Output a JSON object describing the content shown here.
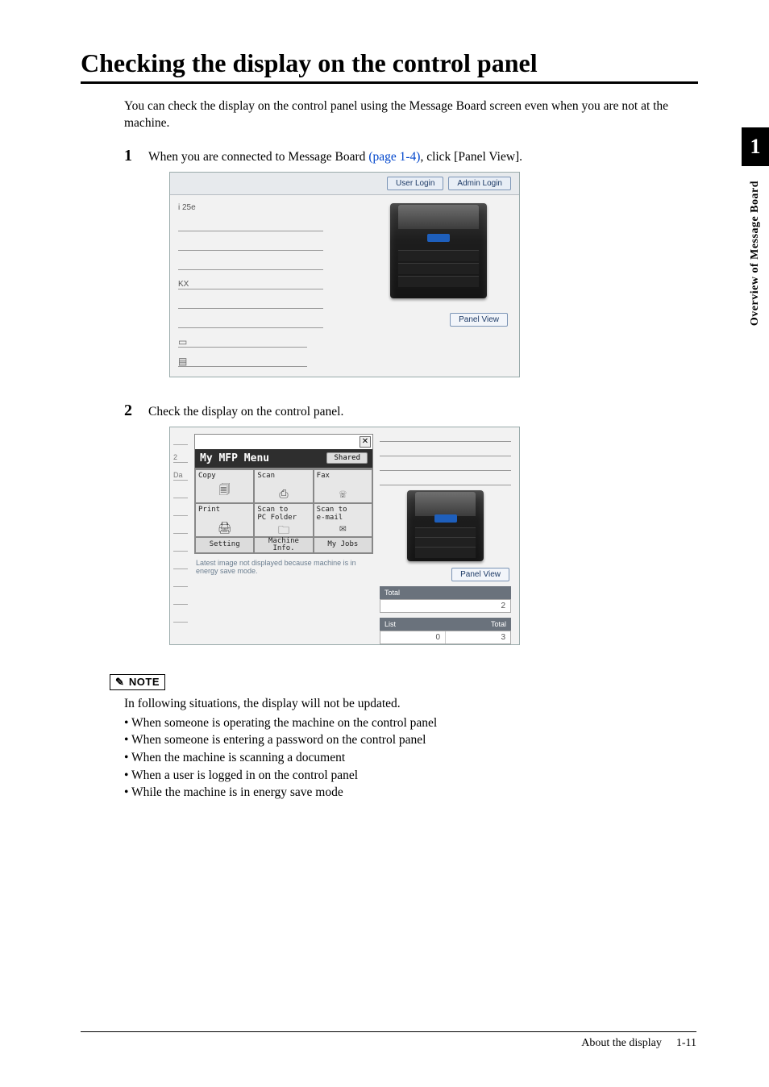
{
  "side": {
    "chapter": "1",
    "label": "Overview of Message Board"
  },
  "title": "Checking the display on the control panel",
  "intro": "You can check the display on the control panel using the Message Board screen even when you are not at the machine.",
  "steps": {
    "s1": {
      "num": "1",
      "t1": "When you are connected to Message Board ",
      "xref": "(page 1-4)",
      "t2": ", click [Panel View]."
    },
    "s2": {
      "num": "2",
      "text": "Check the display on the control panel."
    }
  },
  "shot1": {
    "user_login": "User Login",
    "admin_login": "Admin Login",
    "model": "i 25e",
    "kx": "KX",
    "line_icon_cass": "▭",
    "line_icon_cass2": "▤",
    "panel_view": "Panel View"
  },
  "shot2": {
    "edge": {
      "a": "2",
      "b": "Da"
    },
    "close": "✕",
    "menu_title": "My MFP Menu",
    "shared": "Shared",
    "tiles": {
      "copy": {
        "label": "Copy",
        "glyph": "🗐"
      },
      "scan": {
        "label": "Scan",
        "glyph": "⎙"
      },
      "fax": {
        "label": "Fax",
        "glyph": "☏"
      },
      "print": {
        "label": "Print",
        "glyph": "🖨"
      },
      "scanpc": {
        "label": "Scan to\nPC Folder",
        "glyph": "🗀"
      },
      "scanmail": {
        "label": "Scan to\ne-mail",
        "glyph": "✉"
      }
    },
    "buttons": {
      "setting": "Setting",
      "machinfo": "Machine\nInfo.",
      "myjobs": "My Jobs"
    },
    "msg": "Latest image not displayed because machine is in energy save mode.",
    "panel_view": "Panel View",
    "total_label": "Total",
    "total_val": "2",
    "list_label": "List",
    "total2_label": "Total",
    "v0": "0",
    "v3": "3"
  },
  "note": {
    "label": "NOTE",
    "lead": "In following situations, the display will not be updated.",
    "items": [
      "When someone is operating the machine on the control panel",
      "When someone is entering a password on the control panel",
      "When the machine is scanning a document",
      "When a user is logged in on the control panel",
      "While the machine is in energy save mode"
    ]
  },
  "footer": {
    "section": "About the display",
    "page": "1-11"
  }
}
